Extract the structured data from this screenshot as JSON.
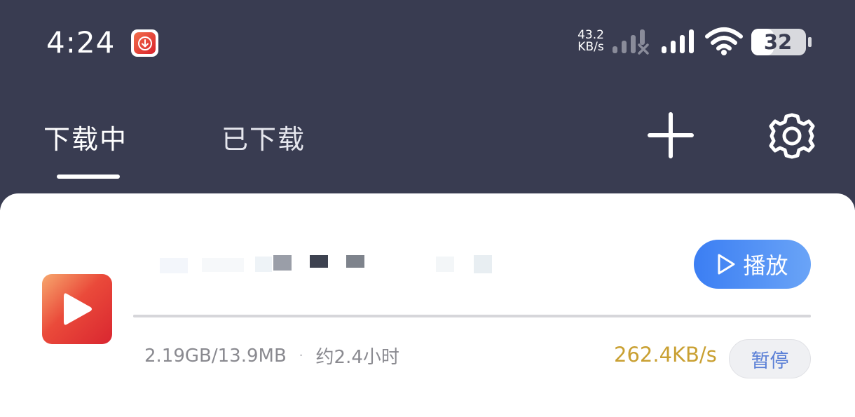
{
  "status_bar": {
    "time": "4:24",
    "net_speed_value": "43.2",
    "net_speed_unit": "KB/s",
    "battery": "32"
  },
  "tabs": [
    {
      "label": "下载中",
      "active": true
    },
    {
      "label": "已下载",
      "active": false
    }
  ],
  "toolbar": {
    "add_icon": "plus-icon",
    "settings_icon": "gear-icon"
  },
  "download": {
    "play_label": "播放",
    "size_text": "2.19GB/13.9MB",
    "separator": "·",
    "eta": "约2.4小时",
    "speed": "262.4KB/s",
    "pause_label": "暂停"
  },
  "colors": {
    "header_bg": "#393c51",
    "accent_blue": "#3b7ef3",
    "speed_gold": "#c9a032",
    "icon_red": "#d92630"
  }
}
